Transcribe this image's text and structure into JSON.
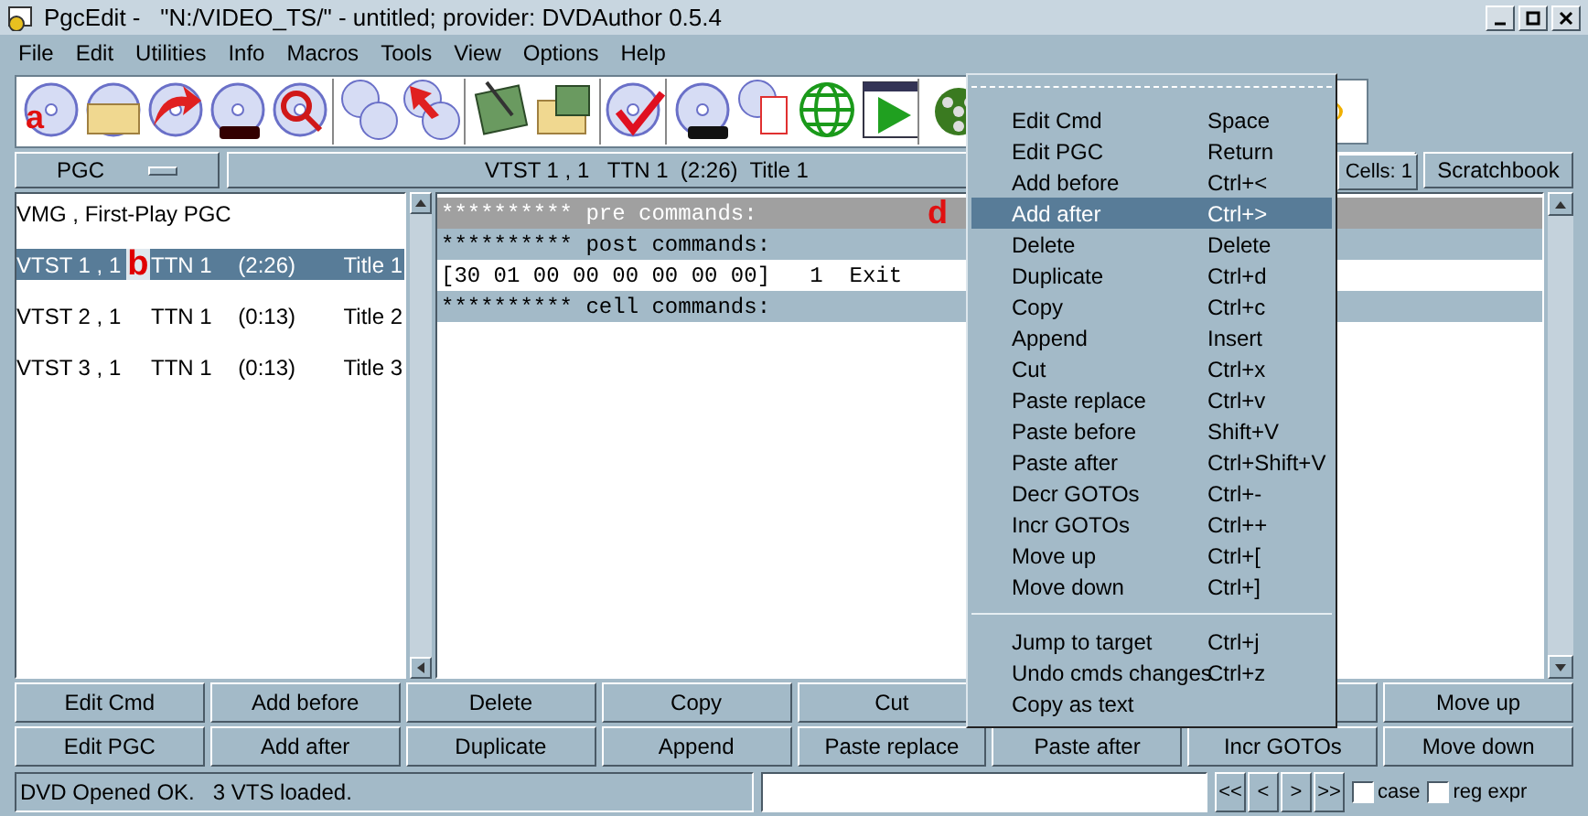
{
  "window": {
    "title": "PgcEdit -   \"N:/VIDEO_TS/\" - untitled; provider: DVDAuthor 0.5.4"
  },
  "menu_bar": [
    "File",
    "Edit",
    "Utilities",
    "Info",
    "Macros",
    "Tools",
    "View",
    "Options",
    "Help"
  ],
  "toolbar": {
    "annotation": "a"
  },
  "pgc_selector": {
    "value": "PGC"
  },
  "info_bar": {
    "text": "VTST 1 , 1   TTN 1  (2:26)  Title 1",
    "cells": "Cells: 1",
    "scratchbook": "Scratchbook"
  },
  "pgc_list": [
    {
      "columns": [
        "VMG , First-Play PGC"
      ],
      "selected": false
    },
    {
      "columns": [
        "VTST 1 , 1",
        "TTN 1",
        "(2:26)",
        "Title 1"
      ],
      "selected": true,
      "annotation": "b"
    },
    {
      "columns": [
        "VTST 2 , 1",
        "TTN 1",
        "(0:13)",
        "Title 2"
      ],
      "selected": false
    },
    {
      "columns": [
        "VTST 3 , 1",
        "TTN 1",
        "(0:13)",
        "Title 3"
      ],
      "selected": false
    }
  ],
  "commands": [
    {
      "kind": "header",
      "text": "********** pre commands:",
      "selected": true,
      "annotation": "d"
    },
    {
      "kind": "header",
      "text": "********** post commands:",
      "selected": false
    },
    {
      "kind": "command",
      "text": "[30 01 00 00 00 00 00 00]   1  Exit",
      "selected": false
    },
    {
      "kind": "header",
      "text": "********** cell commands:",
      "selected": false
    }
  ],
  "context_menu": {
    "sections": [
      [
        {
          "label": "Edit Cmd",
          "shortcut": "Space",
          "selected": false
        },
        {
          "label": "Edit PGC",
          "shortcut": "Return",
          "selected": false
        },
        {
          "label": "Add before",
          "shortcut": "Ctrl+<",
          "selected": false
        },
        {
          "label": "Add after",
          "shortcut": "Ctrl+>",
          "selected": true
        },
        {
          "label": "Delete",
          "shortcut": "Delete",
          "selected": false
        },
        {
          "label": "Duplicate",
          "shortcut": "Ctrl+d",
          "selected": false
        },
        {
          "label": "Copy",
          "shortcut": "Ctrl+c",
          "selected": false
        },
        {
          "label": "Append",
          "shortcut": "Insert",
          "selected": false
        },
        {
          "label": "Cut",
          "shortcut": "Ctrl+x",
          "selected": false
        },
        {
          "label": "Paste replace",
          "shortcut": "Ctrl+v",
          "selected": false
        },
        {
          "label": "Paste before",
          "shortcut": "Shift+V",
          "selected": false
        },
        {
          "label": "Paste after",
          "shortcut": "Ctrl+Shift+V",
          "selected": false
        },
        {
          "label": "Decr GOTOs",
          "shortcut": "Ctrl+-",
          "selected": false
        },
        {
          "label": "Incr GOTOs",
          "shortcut": "Ctrl++",
          "selected": false
        },
        {
          "label": "Move up",
          "shortcut": "Ctrl+[",
          "selected": false
        },
        {
          "label": "Move down",
          "shortcut": "Ctrl+]",
          "selected": false
        }
      ],
      [
        {
          "label": "Jump to target",
          "shortcut": "Ctrl+j",
          "selected": false
        },
        {
          "label": "Undo cmds changes",
          "shortcut": "Ctrl+z",
          "selected": false
        },
        {
          "label": "Copy as text",
          "selected": false
        }
      ]
    ]
  },
  "button_rows": [
    [
      {
        "kind": "button",
        "label": "Edit Cmd"
      },
      {
        "kind": "button",
        "label": "Add before"
      },
      {
        "kind": "button",
        "label": "Delete"
      },
      {
        "kind": "button",
        "label": "Copy"
      },
      {
        "kind": "button",
        "label": "Cut"
      },
      {
        "kind": "gap"
      },
      {
        "kind": "button"
      },
      {
        "kind": "button",
        "label": "Move up"
      }
    ],
    [
      {
        "kind": "button",
        "label": "Edit PGC"
      },
      {
        "kind": "button",
        "label": "Add after"
      },
      {
        "kind": "button",
        "label": "Duplicate"
      },
      {
        "kind": "button",
        "label": "Append"
      },
      {
        "kind": "button",
        "label": "Paste replace"
      },
      {
        "kind": "button",
        "label": "Paste after"
      },
      {
        "kind": "button",
        "label": "Incr GOTOs"
      },
      {
        "kind": "button",
        "label": "Move down"
      }
    ]
  ],
  "status_bar": {
    "message": "DVD Opened OK.   3 VTS loaded.",
    "nav_buttons": [
      "<<",
      "<",
      ">",
      ">>"
    ],
    "checkboxes": [
      {
        "label": "case",
        "checked": false
      },
      {
        "label": "reg expr",
        "checked": false
      }
    ]
  }
}
